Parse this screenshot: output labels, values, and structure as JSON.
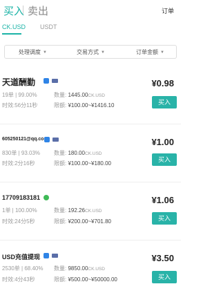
{
  "header": {
    "buy_tab": "买入",
    "sell_tab": "卖出",
    "orders_link": "订单"
  },
  "coins": [
    "CK.USD",
    "USDT"
  ],
  "filters": [
    {
      "label": "处理调度"
    },
    {
      "label": "交易方式"
    },
    {
      "label": "订单金额"
    }
  ],
  "listings": [
    {
      "name": "天道酬勤",
      "orders": "19单 | 99.00%",
      "quantity_label": "数量:",
      "quantity": "1445.00",
      "unit": "CK.USD",
      "time_label": "时效:",
      "time": "56分11秒",
      "limit_label": "限额:",
      "limit": "¥100.00~¥1416.10",
      "price": "¥0.98",
      "button": "买入"
    },
    {
      "name": "605250121@qq.com",
      "orders": "830单 | 93.03%",
      "quantity_label": "数量:",
      "quantity": "180.00",
      "unit": "CK.USD",
      "time_label": "时效:",
      "time": "2分16秒",
      "limit_label": "限额:",
      "limit": "¥100.00~¥180.00",
      "price": "¥1.00",
      "button": "买入"
    },
    {
      "name": "17709183181",
      "orders": "1单 | 100.00%",
      "quantity_label": "数量:",
      "quantity": "192.26",
      "unit": "CK.USD",
      "time_label": "时效:",
      "time": "24分5秒",
      "limit_label": "限额:",
      "limit": "¥200.00~¥701.80",
      "price": "¥1.06",
      "button": "买入"
    },
    {
      "name": "USD充值提现",
      "orders": "2530单 | 68.40%",
      "quantity_label": "数量:",
      "quantity": "9850.00",
      "unit": "CK.USD",
      "time_label": "时效:",
      "time": "4分43秒",
      "limit_label": "限额:",
      "limit": "¥500.00~¥50000.00",
      "price": "¥3.50",
      "button": "买入"
    }
  ],
  "colors": {
    "accent": "#1ab3a6",
    "button": "#29b3a8",
    "verified_badge": "#2f84e6",
    "ok_badge": "#3fba57"
  }
}
